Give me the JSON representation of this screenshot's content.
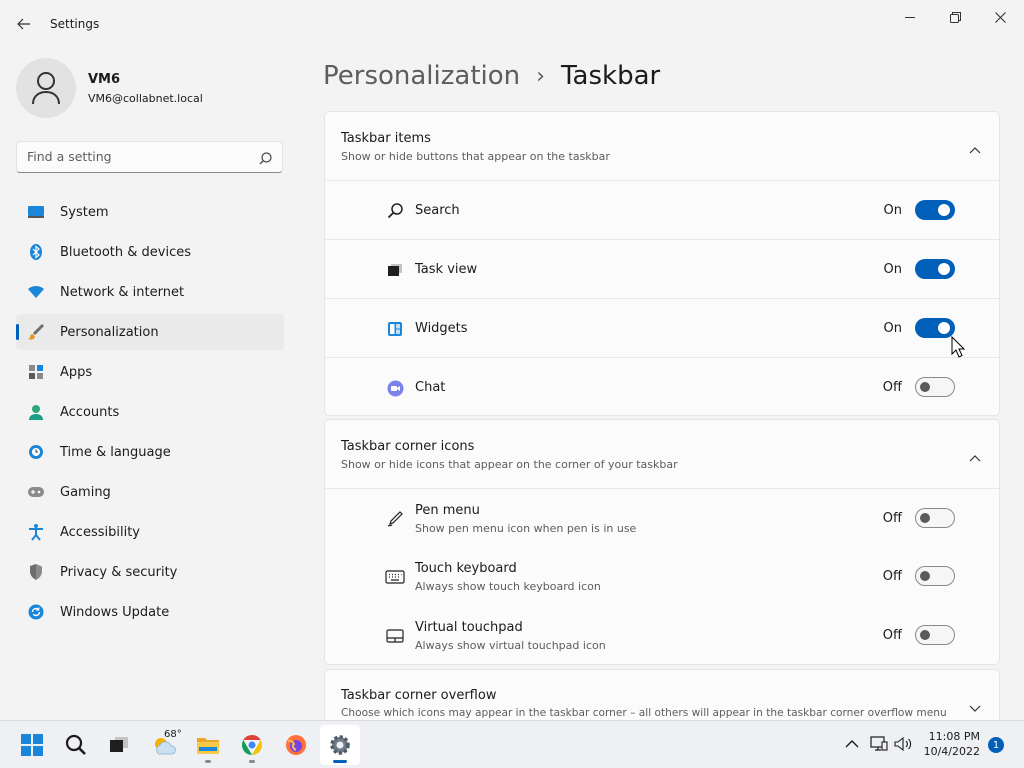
{
  "window": {
    "title": "Settings",
    "controls": [
      "minimize-icon",
      "restore-icon",
      "close-icon"
    ]
  },
  "profile": {
    "name": "VM6",
    "email": "VM6@collabnet.local"
  },
  "search": {
    "placeholder": "Find a setting"
  },
  "sidebar": {
    "items": [
      {
        "label": "System",
        "icon": "system-icon"
      },
      {
        "label": "Bluetooth & devices",
        "icon": "bluetooth-icon"
      },
      {
        "label": "Network & internet",
        "icon": "wifi-icon"
      },
      {
        "label": "Personalization",
        "icon": "brush-icon",
        "active": true
      },
      {
        "label": "Apps",
        "icon": "apps-icon"
      },
      {
        "label": "Accounts",
        "icon": "person-icon"
      },
      {
        "label": "Time & language",
        "icon": "clock-globe-icon"
      },
      {
        "label": "Gaming",
        "icon": "gamepad-icon"
      },
      {
        "label": "Accessibility",
        "icon": "accessibility-icon"
      },
      {
        "label": "Privacy & security",
        "icon": "shield-icon"
      },
      {
        "label": "Windows Update",
        "icon": "update-icon"
      }
    ]
  },
  "breadcrumb": {
    "parent": "Personalization",
    "separator": "›",
    "current": "Taskbar"
  },
  "sections": {
    "taskbar_items": {
      "title": "Taskbar items",
      "subtitle": "Show or hide buttons that appear on the taskbar",
      "expanded": true,
      "rows": [
        {
          "label": "Search",
          "state": "On",
          "on": true,
          "icon": "search-icon"
        },
        {
          "label": "Task view",
          "state": "On",
          "on": true,
          "icon": "task-view-icon"
        },
        {
          "label": "Widgets",
          "state": "On",
          "on": true,
          "icon": "widgets-icon"
        },
        {
          "label": "Chat",
          "state": "Off",
          "on": false,
          "icon": "chat-icon"
        }
      ]
    },
    "corner_icons": {
      "title": "Taskbar corner icons",
      "subtitle": "Show or hide icons that appear on the corner of your taskbar",
      "expanded": true,
      "rows": [
        {
          "label": "Pen menu",
          "desc": "Show pen menu icon when pen is in use",
          "state": "Off",
          "on": false,
          "icon": "pen-icon"
        },
        {
          "label": "Touch keyboard",
          "desc": "Always show touch keyboard icon",
          "state": "Off",
          "on": false,
          "icon": "keyboard-icon"
        },
        {
          "label": "Virtual touchpad",
          "desc": "Always show virtual touchpad icon",
          "state": "Off",
          "on": false,
          "icon": "touchpad-icon"
        }
      ]
    },
    "corner_overflow": {
      "title": "Taskbar corner overflow",
      "subtitle": "Choose which icons may appear in the taskbar corner – all others will appear in the taskbar corner overflow menu",
      "expanded": false
    }
  },
  "taskbar": {
    "apps": [
      "start-icon",
      "search-icon",
      "task-view-icon",
      "weather-widget-icon",
      "file-explorer-icon",
      "chrome-icon",
      "firefox-icon",
      "settings-icon"
    ],
    "weather_temp": "68°",
    "time": "11:08 PM",
    "date": "10/4/2022",
    "notification_count": "1",
    "accent": "#005fb8"
  }
}
